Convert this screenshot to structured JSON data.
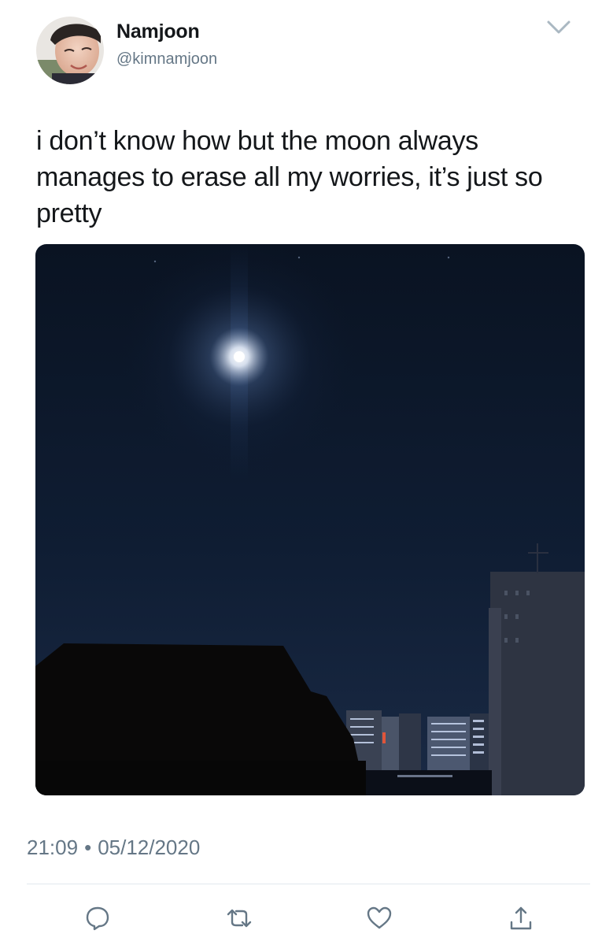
{
  "tweet": {
    "author": {
      "display_name": "Namjoon",
      "handle": "@kimnamjoon"
    },
    "text": "i don’t know how but the moon always manages to erase all my worries, it’s just so pretty",
    "time": "21:09",
    "separator": "•",
    "date": "05/12/2020"
  },
  "actions": [
    {
      "icon": "reply-icon"
    },
    {
      "icon": "retweet-icon"
    },
    {
      "icon": "like-icon"
    },
    {
      "icon": "share-icon"
    }
  ],
  "colors": {
    "text": "#14171a",
    "secondary_text": "#657786",
    "divider": "#e1e8ed",
    "icon": "#657786",
    "night_sky": "#0c1a2c"
  }
}
